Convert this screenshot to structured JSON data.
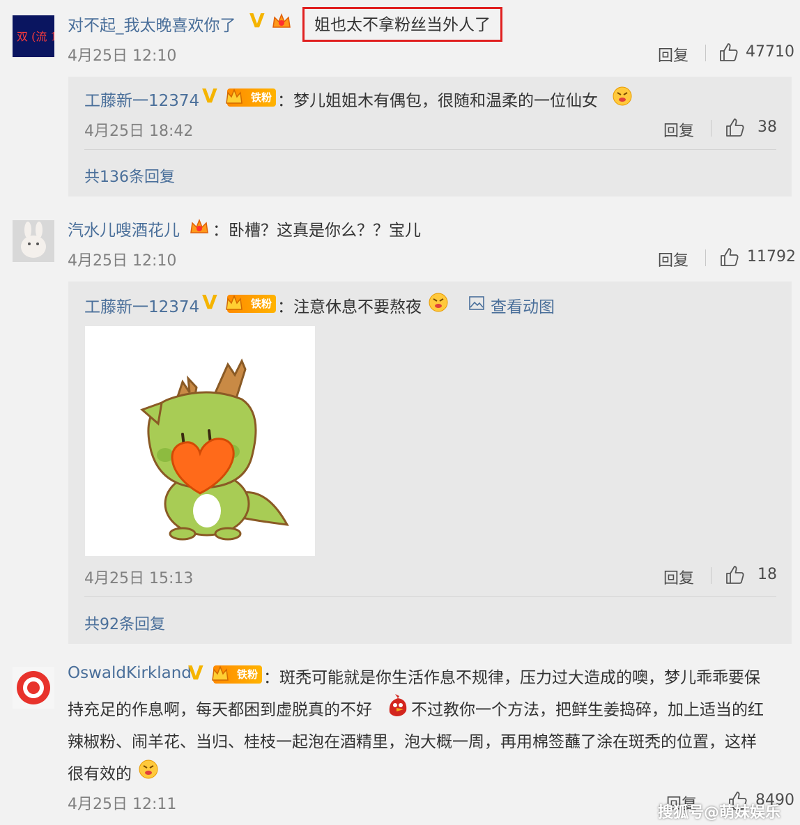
{
  "comments": [
    {
      "username": "对不起_我太晚喜欢你了",
      "text": "姐也太不拿粉丝当外人了",
      "time": "4月25日 12:10",
      "reply_label": "回复",
      "likes": "47710",
      "sub_reply": {
        "username": "工藤新一12374",
        "fan_badge": "铁粉",
        "text": "：梦儿姐姐木有偶包，很随和温柔的一位仙女",
        "time": "4月25日 18:42",
        "reply_label": "回复",
        "likes": "38"
      },
      "more_replies": "共136条回复"
    },
    {
      "username": "汽水儿嗖酒花儿",
      "text": "：卧槽？这真是你么？？宝儿",
      "time": "4月25日 12:10",
      "reply_label": "回复",
      "likes": "11792",
      "sub_reply": {
        "username": "工藤新一12374",
        "fan_badge": "铁粉",
        "text": "：注意休息不要熬夜",
        "view_gif": "查看动图",
        "time": "4月25日 15:13",
        "reply_label": "回复",
        "likes": "18"
      },
      "more_replies": "共92条回复"
    },
    {
      "username": "OswaldKirkland",
      "fan_badge": "铁粉",
      "text_line1": "：斑秃可能就是你生活作息不规律，压力过大造成的噢，梦儿乖乖要保",
      "text_line2a": "持充足的作息啊，每天都困到虚脱真的不好",
      "text_line2b": "不过教你一个方法，把鲜生姜捣碎，加上适当的红",
      "text_line3": "辣椒粉、闹羊花、当归、桂枝一起泡在酒精里，泡大概一周，再用棉签蘸了涂在斑秃的位置，这样",
      "text_line4": "很有效的",
      "time": "4月25日 12:11",
      "reply_label": "回复",
      "likes": "8490"
    }
  ],
  "watermark": "搜狐号@萌妹娱乐",
  "colors": {
    "username": "#4a6f9a",
    "highlight_border": "#e02020",
    "vip_badge": "#f5b400",
    "fan_badge": "#ff8a00"
  },
  "icons": [
    "verified-v-icon",
    "crown-icon",
    "thumbs-up-icon",
    "emoji-face-icon",
    "image-icon",
    "angry-bird-icon"
  ]
}
